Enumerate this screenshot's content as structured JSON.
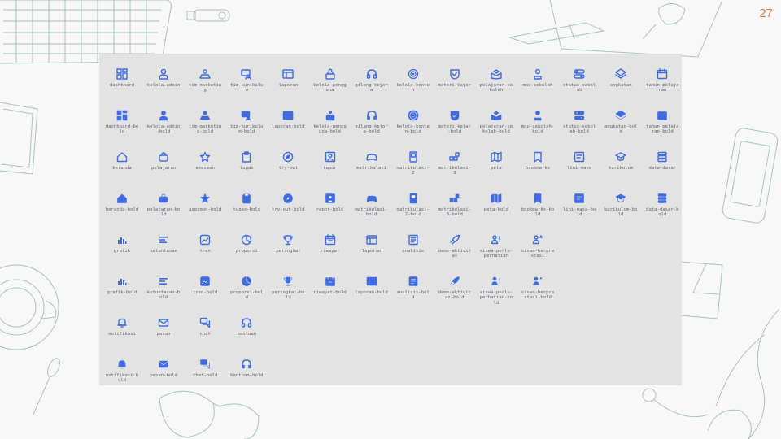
{
  "page_number": "27",
  "accent_color": "#3f6ce0",
  "rows": [
    [
      "dashboard",
      "kelola-admin",
      "tim-marketing",
      "tim-kurikulum",
      "laporan",
      "kelola-pengguna",
      "gilang-kejora",
      "kelola-konten",
      "materi-kejar",
      "pelajaran-sekolah",
      "mou-sekolah",
      "status-sekolah",
      "angkatan",
      "tahun-pelajaran"
    ],
    [
      "dashboard-bold",
      "kelola-admin-bold",
      "tim-marketing-bold",
      "tim-kurikulum-bold",
      "laporan-bold",
      "kelola-pengguna-bold",
      "gilang-kejora-bold",
      "kelola-konten-bold",
      "materi-kejar-bold",
      "pelajaran-sekolah-bold",
      "mou-sekolah-bold",
      "status-sekolah-bold",
      "angkatan-bold",
      "tahun-pelajaran-bold"
    ],
    [
      "beranda",
      "pelajaran",
      "asesmen",
      "tugas",
      "try-out",
      "rapor",
      "matrikulasi",
      "matrikulasi-2",
      "matrikulasi-3",
      "peta",
      "bookmarks",
      "lini-masa",
      "kurikulum",
      "data-dasar"
    ],
    [
      "beranda-bold",
      "pelajaran-bold",
      "asesmen-bold",
      "tugas-bold",
      "try-out-bold",
      "rapor-bold",
      "matrikulasi-bold",
      "matrikulasi-2-bold",
      "matrikulasi-3-bold",
      "peta-bold",
      "bookmarks-bold",
      "lini-masa-bold",
      "kurikulum-bold",
      "data-dasar-bold"
    ],
    [
      "grafik",
      "ketuntasan",
      "tren",
      "proporsi",
      "peringkat",
      "riwayat",
      "laporan",
      "analisis",
      "demo-aktivitas",
      "siswa-perlu-perhatian",
      "siswa-berprestasi"
    ],
    [
      "grafik-bold",
      "ketuntasan-bold",
      "tren-bold",
      "proporsi-bold",
      "peringkat-bold",
      "riwayat-bold",
      "laporan-bold",
      "analisis-bold",
      "demo-aktivitas-bold",
      "siswa-perlu-perhatian-bold",
      "siswa-berprestasi-bold"
    ],
    [
      "notifikasi",
      "pesan",
      "chat",
      "bantuan"
    ],
    [
      "notifikasi-bold",
      "pesan-bold",
      "chat-bold",
      "bantuan-bold"
    ]
  ],
  "labels_wrapped": [
    [
      "dashboard",
      "kelola-admin",
      "tim-marketin\ng",
      "tim-kurikulu\nm",
      "laporan",
      "kelola-pengg\nuna",
      "gilang-kejor\na",
      "kelola-konte\nn",
      "materi-kejar",
      "pelajaran-se\nkolah",
      "mou-sekolah",
      "status-sekol\nah",
      "angkatan",
      "tahun-pelaja\nran"
    ],
    [
      "dashboard-bo\nld",
      "kelola-admin\n-bold",
      "tim-marketin\ng-bold",
      "tim-kurikulu\nm-bold",
      "laporan-bold",
      "kelola-pengg\nuna-bold",
      "gilang-kejor\na-bold",
      "kelola-konte\nn-bold",
      "materi-kejar\n-bold",
      "pelajaran-se\nkolah-bold",
      "mou-sekolah-\nbold",
      "status-sekol\nah-bold",
      "angkatan-bol\nd",
      "tahun-pelaja\nran-bold"
    ],
    [
      "beranda",
      "pelajaran",
      "asesmen",
      "tugas",
      "try-out",
      "rapor",
      "matrikulasi",
      "matrikulasi-\n2",
      "matrikulasi-\n3",
      "peta",
      "bookmarks",
      "lini-masa",
      "kurikulum",
      "data-dasar"
    ],
    [
      "beranda-bold",
      "pelajaran-bo\nld",
      "asesmen-bold",
      "tugas-bold",
      "try-out-bold",
      "rapor-bold",
      "matrikulasi-\nbold",
      "matrikulasi-\n2-bold",
      "matrikulasi-\n3-bold",
      "peta-bold",
      "bookmarks-bo\nld",
      "lini-masa-bo\nld",
      "kurikulum-bo\nld",
      "data-dasar-b\nold"
    ],
    [
      "grafik",
      "ketuntasan",
      "tren",
      "proporsi",
      "peringkat",
      "riwayat",
      "laporan",
      "analisis",
      "demo-aktivit\nas",
      "siswa-perlu-\nperhatian",
      "siswa-berpre\nstasi"
    ],
    [
      "grafik-bold",
      "ketuntasan-b\nold",
      "tren-bold",
      "proporsi-bol\nd",
      "peringkat-bo\nld",
      "riwayat-bold",
      "laporan-bold",
      "analisis-bol\nd",
      "demo-aktivit\nas-bold",
      "siswa-perlu-\nperhatian-bo\nld",
      "siswa-berpre\nstasi-bold"
    ],
    [
      "notifikasi",
      "pesan",
      "chat",
      "bantuan"
    ],
    [
      "notifikasi-b\nold",
      "pesan-bold",
      "chat-bold",
      "bantuan-bold"
    ]
  ],
  "row_icons": [
    [
      "grid-icon",
      "user-icon",
      "team-icon",
      "teacher-icon",
      "report-icon",
      "users-manage-icon",
      "headset-icon",
      "target-icon",
      "shield-book-icon",
      "school-book-icon",
      "person-pin-icon",
      "toggle-status-icon",
      "layers-icon",
      "calendar-icon"
    ],
    [
      "grid-icon",
      "user-icon",
      "team-icon",
      "teacher-icon",
      "report-icon",
      "users-manage-icon",
      "headset-icon",
      "target-icon",
      "shield-book-icon",
      "school-book-icon",
      "person-pin-icon",
      "toggle-status-icon",
      "layers-icon",
      "calendar-icon"
    ],
    [
      "home-icon",
      "book-bag-icon",
      "star-icon",
      "clipboard-icon",
      "compass-icon",
      "portrait-icon",
      "gamepad-icon",
      "phone-card-icon",
      "shapes-icon",
      "map-icon",
      "bookmark-icon",
      "timeline-icon",
      "graduation-cap-icon",
      "database-icon"
    ],
    [
      "home-icon",
      "book-bag-icon",
      "star-icon",
      "clipboard-icon",
      "compass-icon",
      "portrait-icon",
      "gamepad-icon",
      "phone-card-icon",
      "shapes-icon",
      "map-icon",
      "bookmark-icon",
      "timeline-icon",
      "graduation-cap-icon",
      "database-icon"
    ],
    [
      "bar-chart-icon",
      "list-lines-icon",
      "trend-icon",
      "pie-icon",
      "trophy-icon",
      "calendar-history-icon",
      "report-icon",
      "analysis-icon",
      "rocket-icon",
      "attention-user-icon",
      "achiever-user-icon"
    ],
    [
      "bar-chart-icon",
      "list-lines-icon",
      "trend-icon",
      "pie-icon",
      "trophy-icon",
      "calendar-history-icon",
      "report-icon",
      "analysis-icon",
      "rocket-icon",
      "attention-user-icon",
      "achiever-user-icon"
    ],
    [
      "bell-icon",
      "mail-icon",
      "chat-icon",
      "headset-icon"
    ],
    [
      "bell-icon",
      "mail-icon",
      "chat-icon",
      "headset-icon"
    ]
  ]
}
